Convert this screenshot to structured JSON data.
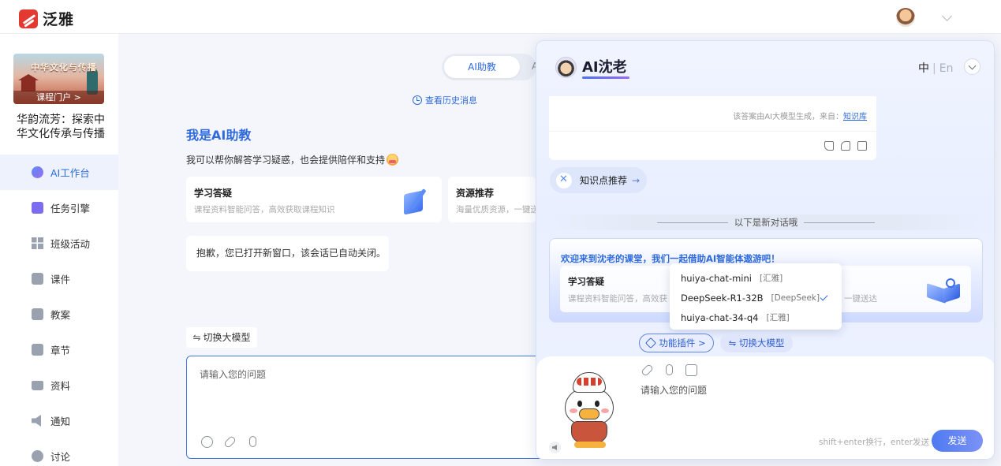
{
  "app": {
    "logo_text": "泛雅"
  },
  "sidebar": {
    "course_portal": "课程门户 >",
    "course_title_art": "中华文化与传播",
    "course_name": "华韵流芳：探索中华文化传承与传播",
    "items": [
      {
        "label": "AI工作台",
        "icon": "ai-icon",
        "active": true
      },
      {
        "label": "任务引擎",
        "icon": "task-icon"
      },
      {
        "label": "班级活动",
        "icon": "grid-icon"
      },
      {
        "label": "课件",
        "icon": "courseware-icon"
      },
      {
        "label": "教案",
        "icon": "lesson-plan-icon"
      },
      {
        "label": "章节",
        "icon": "chapter-icon"
      },
      {
        "label": "资料",
        "icon": "folder-icon"
      },
      {
        "label": "通知",
        "icon": "speaker-icon"
      },
      {
        "label": "讨论",
        "icon": "chat-icon"
      }
    ]
  },
  "main": {
    "tabs": {
      "active": "AI助教",
      "second": "A"
    },
    "history_link": "查看历史消息",
    "hello_title": "我是AI助教",
    "hello_sub": "我可以帮你解答学习疑惑，也会提供陪伴和支持",
    "cards": [
      {
        "title": "学习答疑",
        "desc": "课程资料智能问答，高效获取课程知识"
      },
      {
        "title": "资源推荐",
        "desc": "海量优质资源，一键送达"
      }
    ],
    "notice": "抱歉，您已打开新窗口，该会话已自动关闭。",
    "switch_model": "切换大模型",
    "input_placeholder": "请输入您的问题"
  },
  "ai_panel": {
    "name": "AI沈老",
    "lang_zh": "中",
    "lang_sep": "|",
    "lang_en": "En",
    "answer_source_prefix": "该答案由AI大模型生成，来自：",
    "answer_source_link": "知识库",
    "knowledge_btn": "知识点推荐",
    "new_topic": "以下是新对话哦",
    "welcome_title": "欢迎来到沈老的课堂，我们一起借助AI智能体遨游吧！",
    "welcome_card": {
      "title": "学习答疑",
      "desc": "课程资料智能问答，高效获",
      "desc_tail": "一键送达"
    },
    "models": [
      {
        "name": "huiya-chat-mini",
        "tag": "[汇雅]",
        "selected": false
      },
      {
        "name": "DeepSeek-R1-32B",
        "tag": "[DeepSeek]",
        "selected": true
      },
      {
        "name": "huiya-chat-34-q4",
        "tag": "[汇雅]",
        "selected": false
      }
    ],
    "plugin_btn": "功能插件 >",
    "switch_model": "切换大模型",
    "input_placeholder": "请输入您的问题",
    "hint": "shift+enter换行，enter发送",
    "send": "发送"
  },
  "colors": {
    "accent": "#2f6bdc",
    "brand_red": "#e23a30"
  }
}
